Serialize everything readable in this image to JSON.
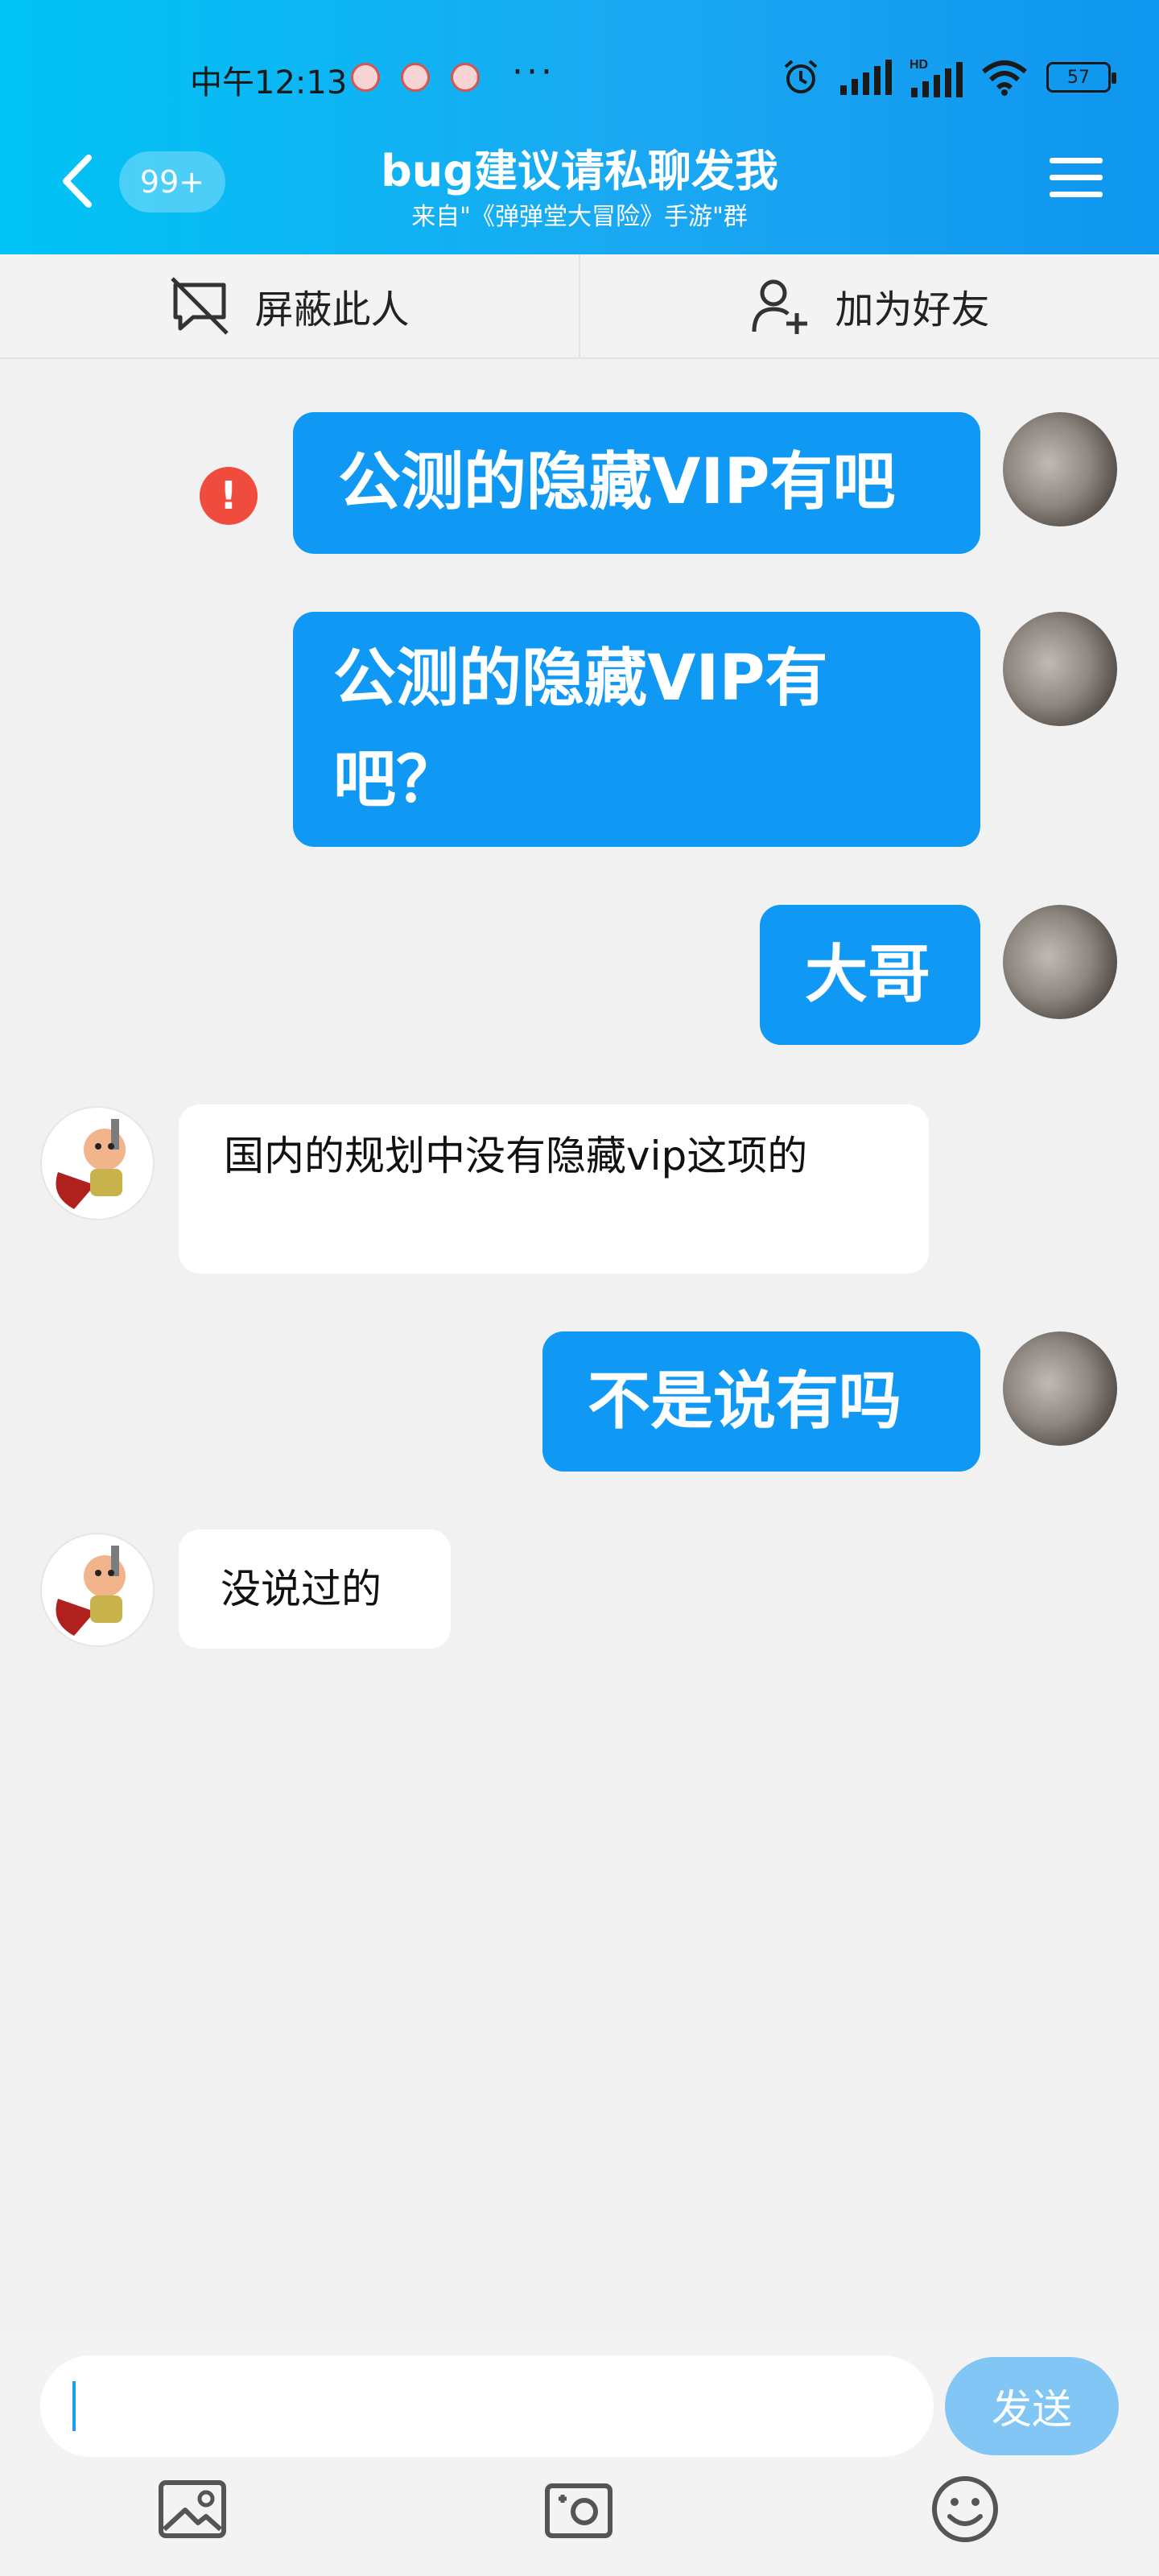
{
  "status_bar": {
    "time": "中午12:13",
    "more": "···",
    "battery": "57"
  },
  "header": {
    "unread_badge": "99+",
    "title": "bug建议请私聊发我",
    "subtitle": "来自\"《弹弹堂大冒险》手游\"群"
  },
  "actions": {
    "block": "屏蔽此人",
    "add_friend": "加为好友"
  },
  "messages": [
    {
      "from": "me",
      "text": "公测的隐藏VIP有吧",
      "failed": true
    },
    {
      "from": "me",
      "text": "公测的隐藏VIP有吧？"
    },
    {
      "from": "me",
      "text": "大哥"
    },
    {
      "from": "other",
      "text": "国内的规划中没有隐藏vip这项的"
    },
    {
      "from": "me",
      "text": "不是说有吗"
    },
    {
      "from": "other",
      "text": "没说过的"
    }
  ],
  "input": {
    "send_label": "发送"
  },
  "colors": {
    "header_start": "#00c4f5",
    "header_end": "#0f96ef",
    "outgoing_bubble": "#0f98f4",
    "incoming_bubble": "#ffffff",
    "error": "#f04c3e",
    "send_button": "#82c6f5"
  },
  "icons": [
    "back-icon",
    "menu-icon",
    "block-icon",
    "add-friend-icon",
    "error-icon",
    "image-icon",
    "camera-icon",
    "emoji-icon"
  ]
}
